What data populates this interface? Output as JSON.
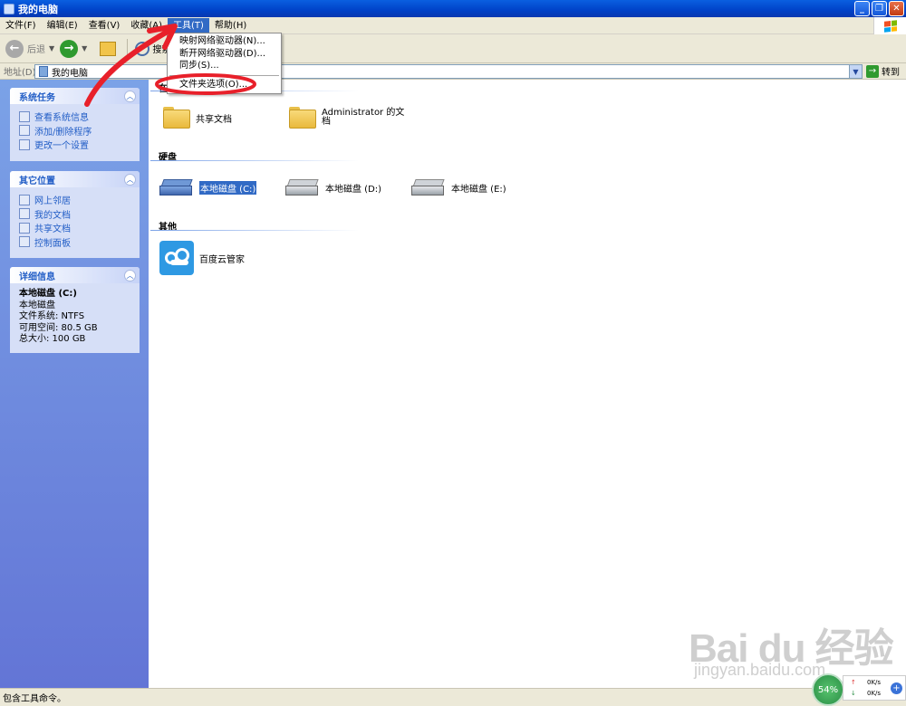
{
  "window": {
    "title": "我的电脑"
  },
  "menubar": {
    "items": [
      "文件(F)",
      "编辑(E)",
      "查看(V)",
      "收藏(A)",
      "工具(T)",
      "帮助(H)"
    ]
  },
  "toolbar": {
    "back": "后退",
    "search": "搜索"
  },
  "address": {
    "label": "地址(D)",
    "value": "我的电脑",
    "go": "转到"
  },
  "tools_menu": {
    "items": [
      "映射网络驱动器(N)...",
      "断开网络驱动器(D)...",
      "同步(S)...",
      "文件夹选项(O)..."
    ]
  },
  "left": {
    "system_tasks": {
      "title": "系统任务",
      "links": [
        "查看系统信息",
        "添加/删除程序",
        "更改一个设置"
      ]
    },
    "other_places": {
      "title": "其它位置",
      "links": [
        "网上邻居",
        "我的文档",
        "共享文档",
        "控制面板"
      ]
    },
    "details": {
      "title": "详细信息",
      "name": "本地磁盘 (C:)",
      "type": "本地磁盘",
      "fs": "文件系统: NTFS",
      "free": "可用空间: 80.5 GB",
      "total": "总大小: 100 GB"
    }
  },
  "main": {
    "section_files": "在",
    "shared_docs": "共享文档",
    "admin_docs_1": "Administrator 的文",
    "admin_docs_2": "档",
    "section_drives": "硬盘",
    "drive_c": "本地磁盘 (C:)",
    "drive_d": "本地磁盘 (D:)",
    "drive_e": "本地磁盘 (E:)",
    "section_other": "其他",
    "baidu": "百度云管家"
  },
  "status": {
    "text": "包含工具命令。"
  },
  "tray": {
    "percent": "54%",
    "up": "0K/s",
    "down": "0K/s"
  },
  "watermark": {
    "brand": "Bai du 经验",
    "url": "jingyan.baidu.com"
  },
  "colors": {
    "title": "#0042c8",
    "menu_highlight": "#316ac5",
    "annotation": "#e8202a"
  }
}
